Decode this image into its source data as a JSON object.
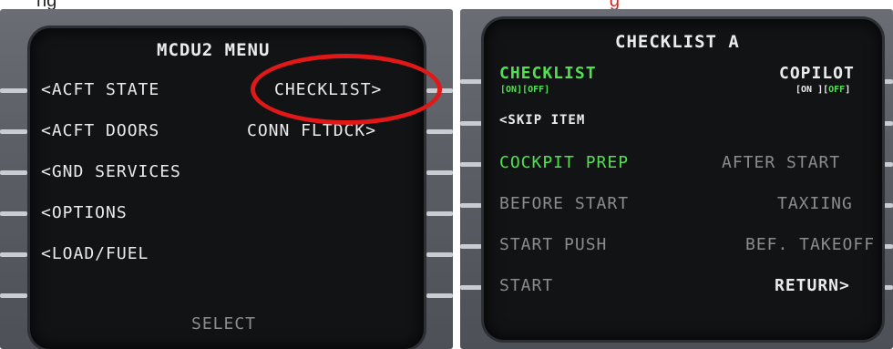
{
  "captions": {
    "left": "ng",
    "right": "g"
  },
  "left_mcdu": {
    "title": "MCDU2 MENU",
    "left_items": [
      "<ACFT STATE",
      "<ACFT DOORS",
      "<GND SERVICES",
      "<OPTIONS",
      "<LOAD/FUEL"
    ],
    "right_items": [
      "CHECKLIST>",
      "CONN FLTDCK>"
    ],
    "footer": "SELECT",
    "highlight_color": "#e01818"
  },
  "right_mcdu": {
    "title": "CHECKLIST A",
    "checklist": {
      "label": "CHECKLIST",
      "toggle": "[ON][OFF]"
    },
    "copilot": {
      "label": "COPILOT",
      "toggle_on": "[ON ][",
      "toggle_off": "OFF",
      "toggle_end": "]"
    },
    "skip_item": "<SKIP ITEM",
    "left_items": [
      "COCKPIT PREP",
      "BEFORE START",
      "START PUSH",
      "START"
    ],
    "right_items": [
      "AFTER START",
      "TAXIING",
      "BEF. TAKEOFF",
      "RETURN>"
    ],
    "colors": {
      "active": "#52e052",
      "inactive": "#8a8c8f",
      "text": "#ebebeb"
    }
  }
}
